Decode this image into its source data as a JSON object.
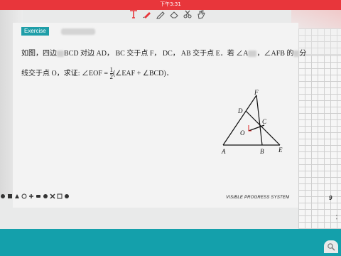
{
  "status": {
    "time": "下午3:31"
  },
  "toolbar": {
    "tools": [
      "text-tool",
      "pen-tool",
      "pencil-tool",
      "eraser-tool",
      "scissors-tool",
      "hand-tool"
    ]
  },
  "tag": {
    "label": "Exercise"
  },
  "problem": {
    "line1_a": "如图，四边",
    "line1_b": "BCD 对边 AD， BC 交于点 F， DC， AB 交于点 E．若 ∠A",
    "line1_c": "，∠AFB 的",
    "line1_d": "分",
    "line2_a": "线交于点 O，求证: ∠EOF =",
    "frac_num": "1",
    "frac_den": "2",
    "line2_b": "(∠EAF + ∠BCD)．"
  },
  "figure": {
    "labels": {
      "F": "F",
      "D": "D",
      "C": "C",
      "O": "O",
      "A": "A",
      "B": "B",
      "E": "E"
    }
  },
  "footer": {
    "system": "VISIBLE PROGRESS SYSTEM",
    "page": "9"
  },
  "zoom": {
    "icon": "zoom-icon"
  }
}
